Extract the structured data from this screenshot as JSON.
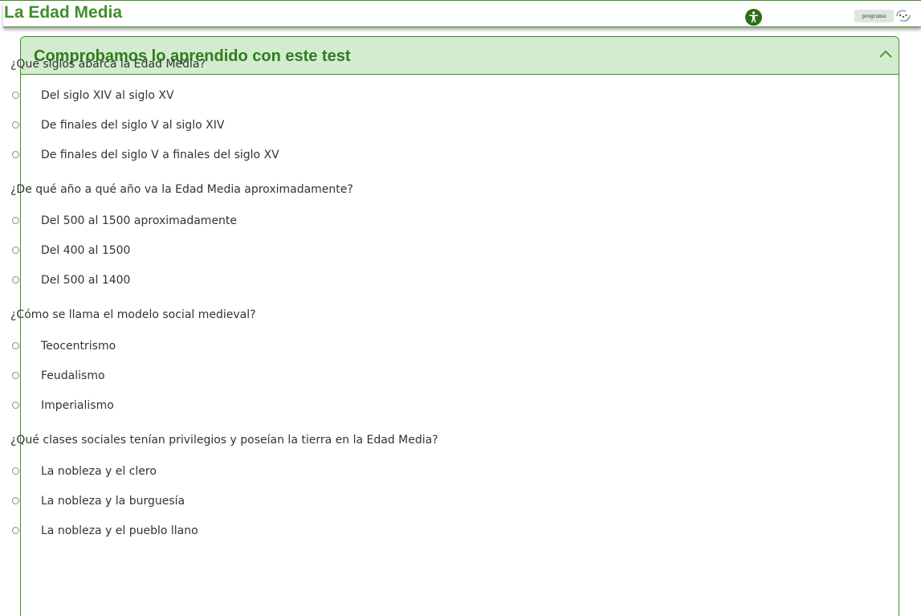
{
  "header": {
    "title": "La Edad Media",
    "accessibility_icon": "accessibility-icon",
    "program_badge": "programa",
    "program_logo_icon": "program-logo-icon"
  },
  "colors": {
    "brand_green": "#3f8f2a",
    "header_bg": "#d3ebcf",
    "title_green": "#2f7d1e"
  },
  "card": {
    "title": "Comprobamos lo aprendido con este test",
    "collapse_icon": "chevron-up-icon"
  },
  "questions": [
    {
      "text": "¿Qué siglos abarca la Edad Media?",
      "options": [
        "Del siglo XIV al siglo XV",
        "De finales del siglo V al siglo XIV",
        "De finales del siglo V a finales del siglo XV"
      ]
    },
    {
      "text": "¿De qué año a qué año va la Edad Media aproximadamente?",
      "options": [
        "Del 500 al 1500 aproximadamente",
        "Del 400 al 1500",
        "Del 500 al 1400"
      ]
    },
    {
      "text": "¿Cómo se llama el modelo social medieval?",
      "options": [
        "Teocentrismo",
        "Feudalismo",
        "Imperialismo"
      ]
    },
    {
      "text": "¿Qué clases sociales tenían privilegios y poseían la tierra en la Edad Media?",
      "options": [
        "La nobleza y el clero",
        "La nobleza y la burguesía",
        "La nobleza y el pueblo llano"
      ]
    }
  ]
}
